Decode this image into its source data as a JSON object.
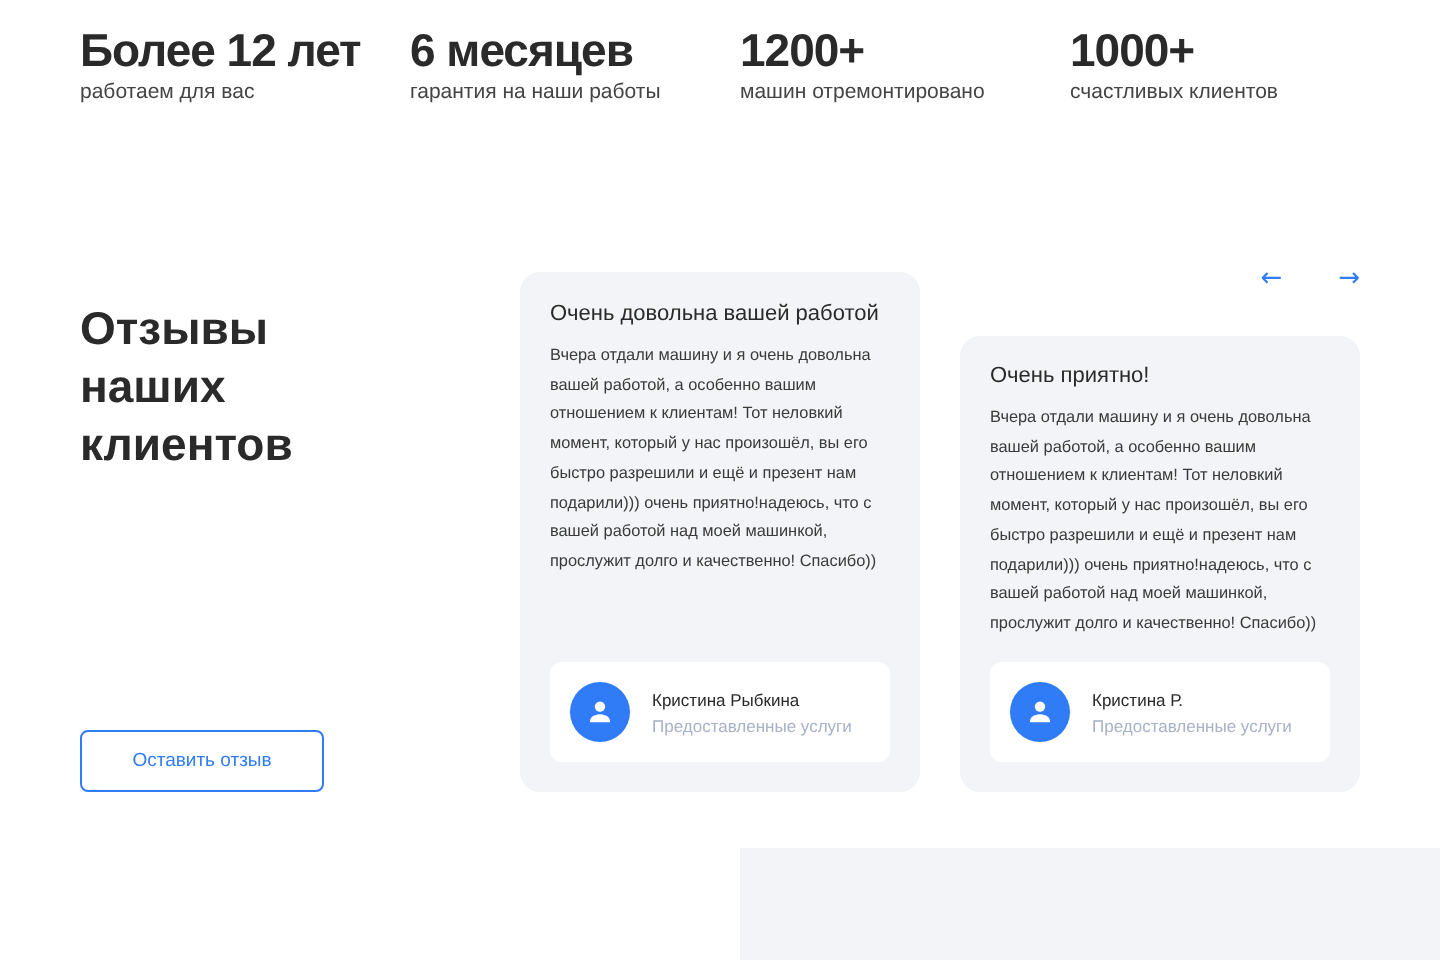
{
  "stats": [
    {
      "value": "Более 12 лет",
      "label": "работаем для вас"
    },
    {
      "value": "6 месяцев",
      "label": "гарантия на наши работы"
    },
    {
      "value": "1200+",
      "label": "машин отремонтировано"
    },
    {
      "value": "1000+",
      "label": "счастливых клиентов"
    }
  ],
  "reviews_section": {
    "heading": "Отзывы наших клиентов",
    "button": "Оставить отзыв",
    "nav": [
      "←",
      "→"
    ],
    "reviews": [
      {
        "title": "Очень довольна вашей работой",
        "text": "Вчера отдали машину и я очень довольна вашей работой, а особенно вашим отношением к клиентам! Тот неловкий момент, который у нас произошёл, вы его быстро разрешили и ещё и презент нам подарили))) очень приятно!надеюсь, что с вашей работой над моей машинкой, прослужит долго и качественно! Спасибо))",
        "author": "Кристина Рыбкина",
        "service": "Предоставленные услуги",
        "selected": true
      },
      {
        "title": "Очень приятно!",
        "text": "Вчера отдали машину и я очень довольна вашей работой, а особенно вашим отношением к клиентам! Тот неловкий момент, который у нас произошёл, вы его быстро разрешили и ещё и презент нам подарили))) очень приятно!надеюсь, что с вашей работой над моей машинкой, прослужит долго и качественно! Спасибо))",
        "author": "Кристина Р.",
        "service": "Предоставленные услуги",
        "selected": false
      }
    ]
  }
}
